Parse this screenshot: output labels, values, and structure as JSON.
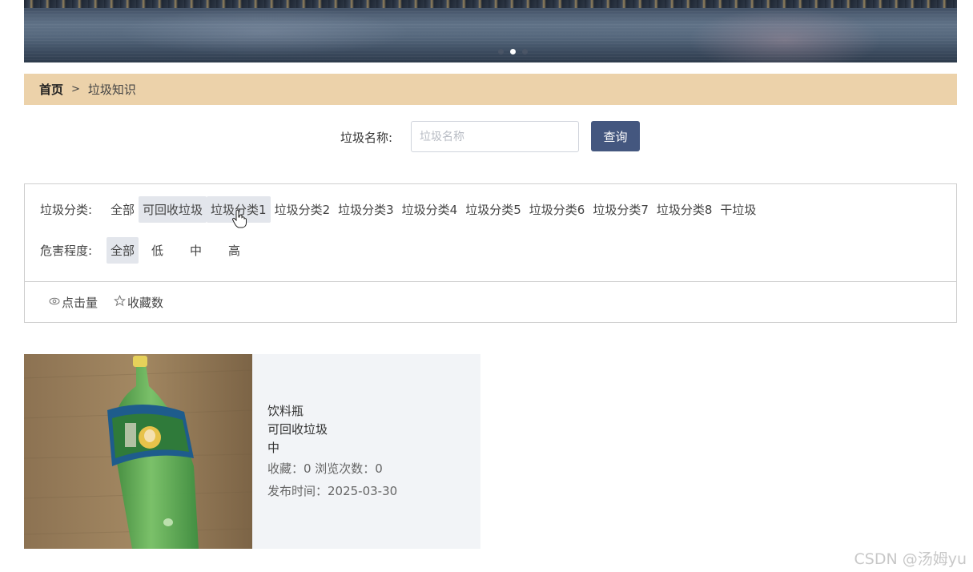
{
  "banner": {
    "dots": 3,
    "active_dot": 1
  },
  "breadcrumb": {
    "home": "首页",
    "separator": ">",
    "current": "垃圾知识"
  },
  "search": {
    "label": "垃圾名称:",
    "placeholder": "垃圾名称",
    "value": "",
    "button": "查询"
  },
  "filters": {
    "category": {
      "title": "垃圾分类:",
      "options": [
        "全部",
        "可回收垃圾",
        "垃圾分类1",
        "垃圾分类2",
        "垃圾分类3",
        "垃圾分类4",
        "垃圾分类5",
        "垃圾分类6",
        "垃圾分类7",
        "垃圾分类8",
        "干垃圾"
      ],
      "selected": "可回收垃圾",
      "hovered": "垃圾分类1"
    },
    "hazard": {
      "title": "危害程度:",
      "options": [
        "全部",
        "低",
        "中",
        "高"
      ],
      "selected": "全部"
    }
  },
  "sort": {
    "clicks": {
      "icon": "eye-icon",
      "label": "点击量"
    },
    "favorites": {
      "icon": "star-icon",
      "label": "收藏数"
    }
  },
  "items": [
    {
      "name": "饮料瓶",
      "category": "可回收垃圾",
      "hazard": "中",
      "stats": "收藏：0  浏览次数：0",
      "published": "发布时间：2025-03-30"
    }
  ],
  "watermark": "CSDN @汤姆yu",
  "colors": {
    "breadcrumb_bg": "#ecd2aa",
    "button_bg": "#44577f",
    "highlight_bg": "#e3e6ec",
    "card_bg": "#f2f4f7"
  }
}
